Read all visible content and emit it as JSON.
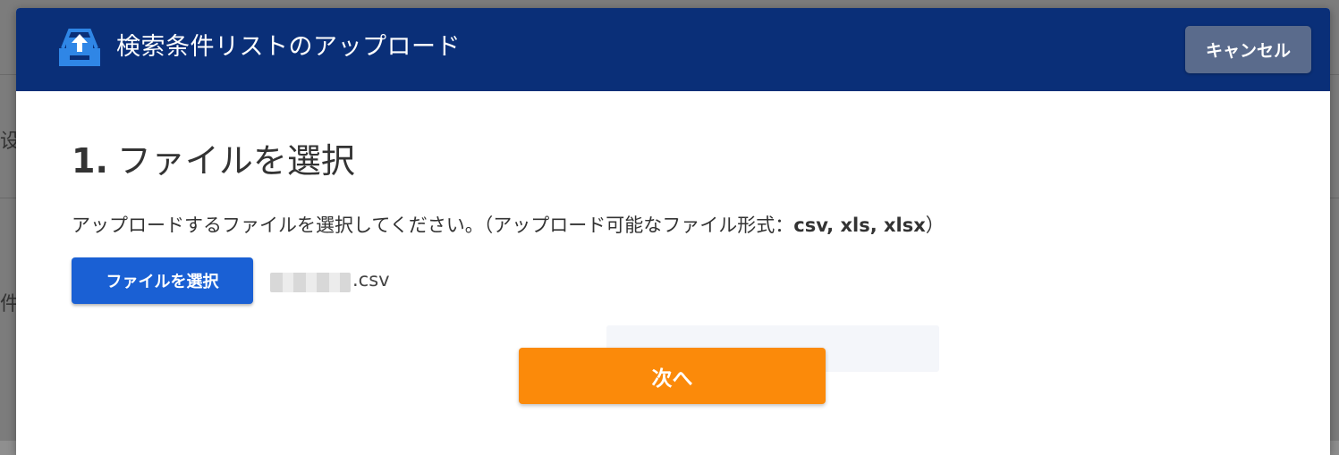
{
  "background": {
    "left_text_1": "设",
    "left_text_2": "件"
  },
  "header": {
    "icon": "upload-tray-icon",
    "title": "検索条件リストのアップロード",
    "cancel_label": "キャンセル",
    "color": "#0a2f78"
  },
  "step": {
    "number": "1.",
    "title": "ファイルを選択"
  },
  "description": {
    "text": "アップロードするファイルを選択してください。（アップロード可能なファイル形式：",
    "formats": "csv, xls, xlsx",
    "suffix": "）"
  },
  "file": {
    "choose_label": "ファイルを選択",
    "extension": ".csv"
  },
  "next_label": "次へ",
  "colors": {
    "primary_button": "#1a60d4",
    "next_button": "#fb8a0a",
    "cancel_button": "#5a6b8c"
  }
}
